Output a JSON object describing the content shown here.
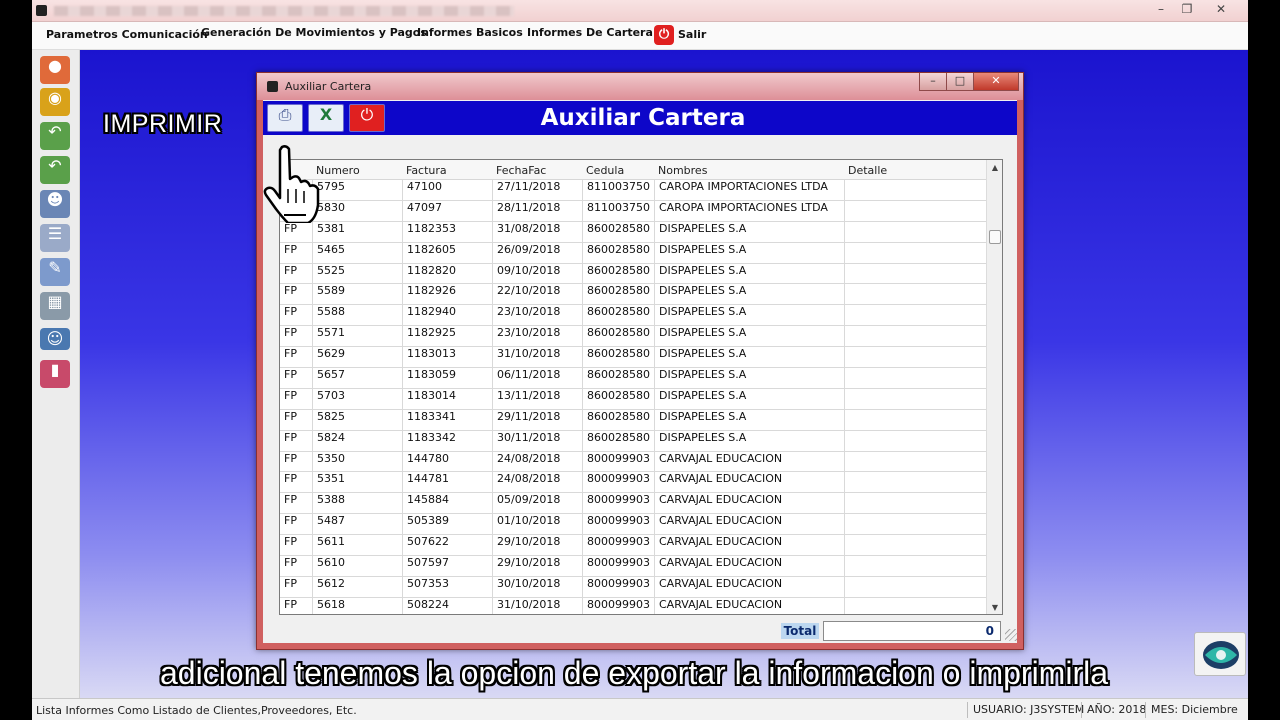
{
  "menu": {
    "items": [
      "Parametros Comunicación",
      "Generación De Movimientos y Pagos",
      "Informes Basicos",
      "Informes De Cartera"
    ],
    "salir": "Salir"
  },
  "window": {
    "title": "Auxiliar Cartera",
    "heading": "Auxiliar Cartera"
  },
  "annotation": "IMPRIMIR",
  "grid": {
    "columns": [
      "Numero",
      "Factura",
      "FechaFac",
      "Cedula",
      "Nombres",
      "Detalle"
    ],
    "rows": [
      [
        "FP",
        "5795",
        "47100",
        "27/11/2018",
        "811003750",
        "CAROPA IMPORTACIONES LTDA",
        ""
      ],
      [
        "FP",
        "5830",
        "47097",
        "28/11/2018",
        "811003750",
        "CAROPA IMPORTACIONES LTDA",
        ""
      ],
      [
        "FP",
        "5381",
        "1182353",
        "31/08/2018",
        "860028580",
        "DISPAPELES S.A",
        ""
      ],
      [
        "FP",
        "5465",
        "1182605",
        "26/09/2018",
        "860028580",
        "DISPAPELES S.A",
        ""
      ],
      [
        "FP",
        "5525",
        "1182820",
        "09/10/2018",
        "860028580",
        "DISPAPELES S.A",
        ""
      ],
      [
        "FP",
        "5589",
        "1182926",
        "22/10/2018",
        "860028580",
        "DISPAPELES S.A",
        ""
      ],
      [
        "FP",
        "5588",
        "1182940",
        "23/10/2018",
        "860028580",
        "DISPAPELES S.A",
        ""
      ],
      [
        "FP",
        "5571",
        "1182925",
        "23/10/2018",
        "860028580",
        "DISPAPELES S.A",
        ""
      ],
      [
        "FP",
        "5629",
        "1183013",
        "31/10/2018",
        "860028580",
        "DISPAPELES S.A",
        ""
      ],
      [
        "FP",
        "5657",
        "1183059",
        "06/11/2018",
        "860028580",
        "DISPAPELES S.A",
        ""
      ],
      [
        "FP",
        "5703",
        "1183014",
        "13/11/2018",
        "860028580",
        "DISPAPELES S.A",
        ""
      ],
      [
        "FP",
        "5825",
        "1183341",
        "29/11/2018",
        "860028580",
        "DISPAPELES S.A",
        ""
      ],
      [
        "FP",
        "5824",
        "1183342",
        "30/11/2018",
        "860028580",
        "DISPAPELES S.A",
        ""
      ],
      [
        "FP",
        "5350",
        "144780",
        "24/08/2018",
        "800099903",
        "CARVAJAL EDUCACION",
        ""
      ],
      [
        "FP",
        "5351",
        "144781",
        "24/08/2018",
        "800099903",
        "CARVAJAL EDUCACION",
        ""
      ],
      [
        "FP",
        "5388",
        "145884",
        "05/09/2018",
        "800099903",
        "CARVAJAL EDUCACION",
        ""
      ],
      [
        "FP",
        "5487",
        "505389",
        "01/10/2018",
        "800099903",
        "CARVAJAL EDUCACION",
        ""
      ],
      [
        "FP",
        "5611",
        "507622",
        "29/10/2018",
        "800099903",
        "CARVAJAL EDUCACION",
        ""
      ],
      [
        "FP",
        "5610",
        "507597",
        "29/10/2018",
        "800099903",
        "CARVAJAL EDUCACION",
        ""
      ],
      [
        "FP",
        "5612",
        "507353",
        "30/10/2018",
        "800099903",
        "CARVAJAL EDUCACION",
        ""
      ],
      [
        "FP",
        "5618",
        "508224",
        "31/10/2018",
        "800099903",
        "CARVAJAL EDUCACION",
        ""
      ]
    ]
  },
  "total": {
    "label": "Total",
    "value": "0"
  },
  "status": {
    "left": "Lista Informes Como Listado de Clientes,Proveedores, Etc.",
    "usuario": "USUARIO: J3SYSTEM",
    "anio": "AÑO: 2018",
    "mes": "MES: Diciembre"
  },
  "subtitle": "adicional tenemos la opcion de exportar la informacion o imprimirla",
  "colors": {
    "background_blue": "#1b14cf",
    "toolbar_blue": "#0d06c9",
    "window_frame": "#d06060"
  },
  "icons": [
    "print-icon",
    "excel-export-icon",
    "power-exit-icon",
    "hand-cursor-icon",
    "coins-icon",
    "undo-icon",
    "redo-icon",
    "user-card-icon",
    "document-icon",
    "edit-document-icon",
    "book-icon",
    "group-icon",
    "chart-icon"
  ]
}
